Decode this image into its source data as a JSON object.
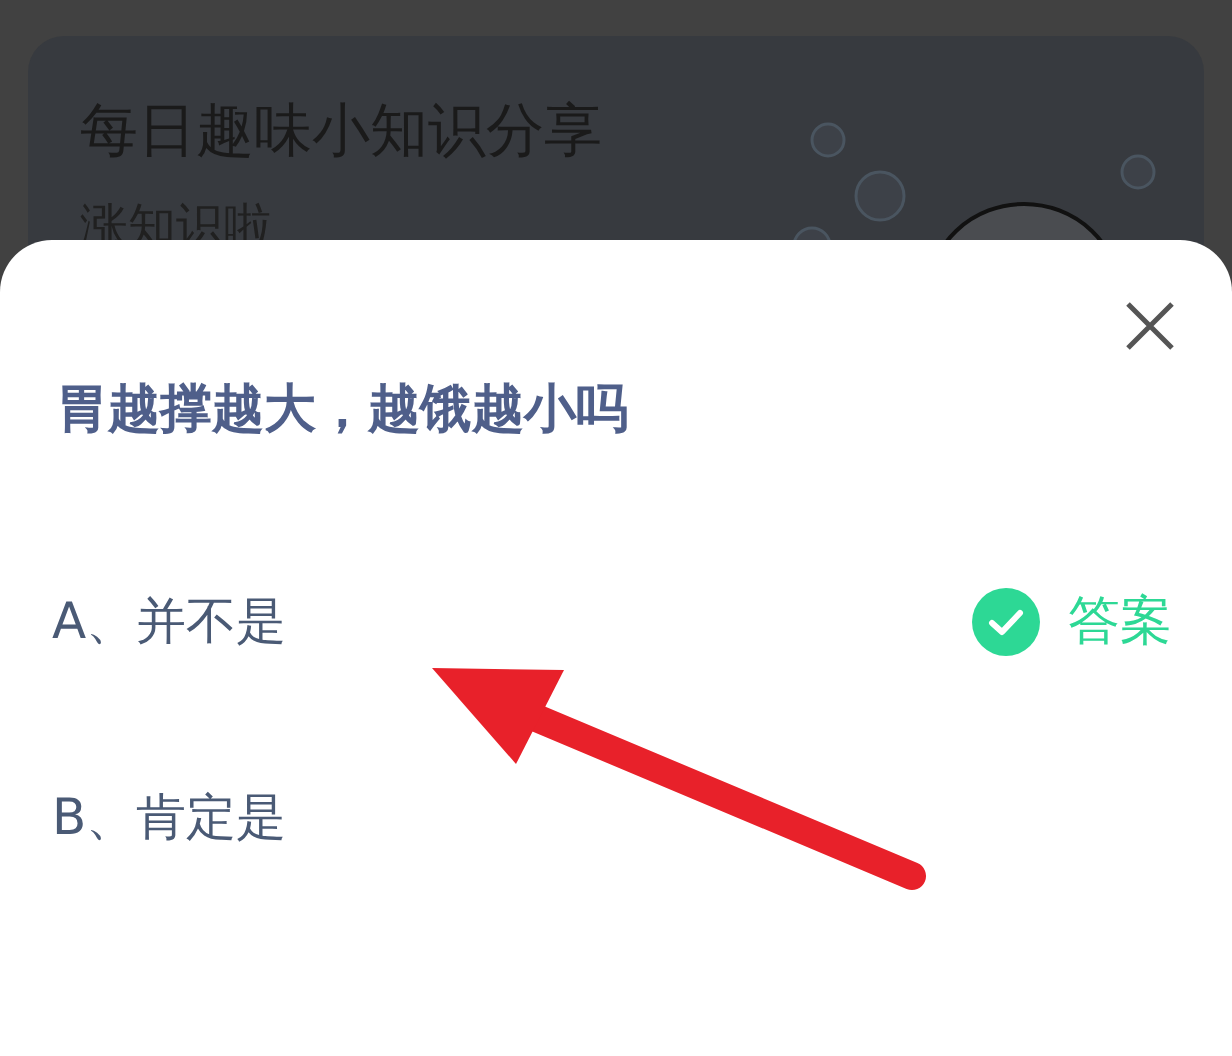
{
  "card": {
    "title": "每日趣味小知识分享",
    "subtitle": "涨知识啦"
  },
  "quiz": {
    "question": "胃越撑越大，越饿越小吗",
    "options": [
      {
        "label": "A、并不是",
        "correct": true
      },
      {
        "label": "B、肯定是",
        "correct": false
      }
    ],
    "answer_label": "答案"
  }
}
